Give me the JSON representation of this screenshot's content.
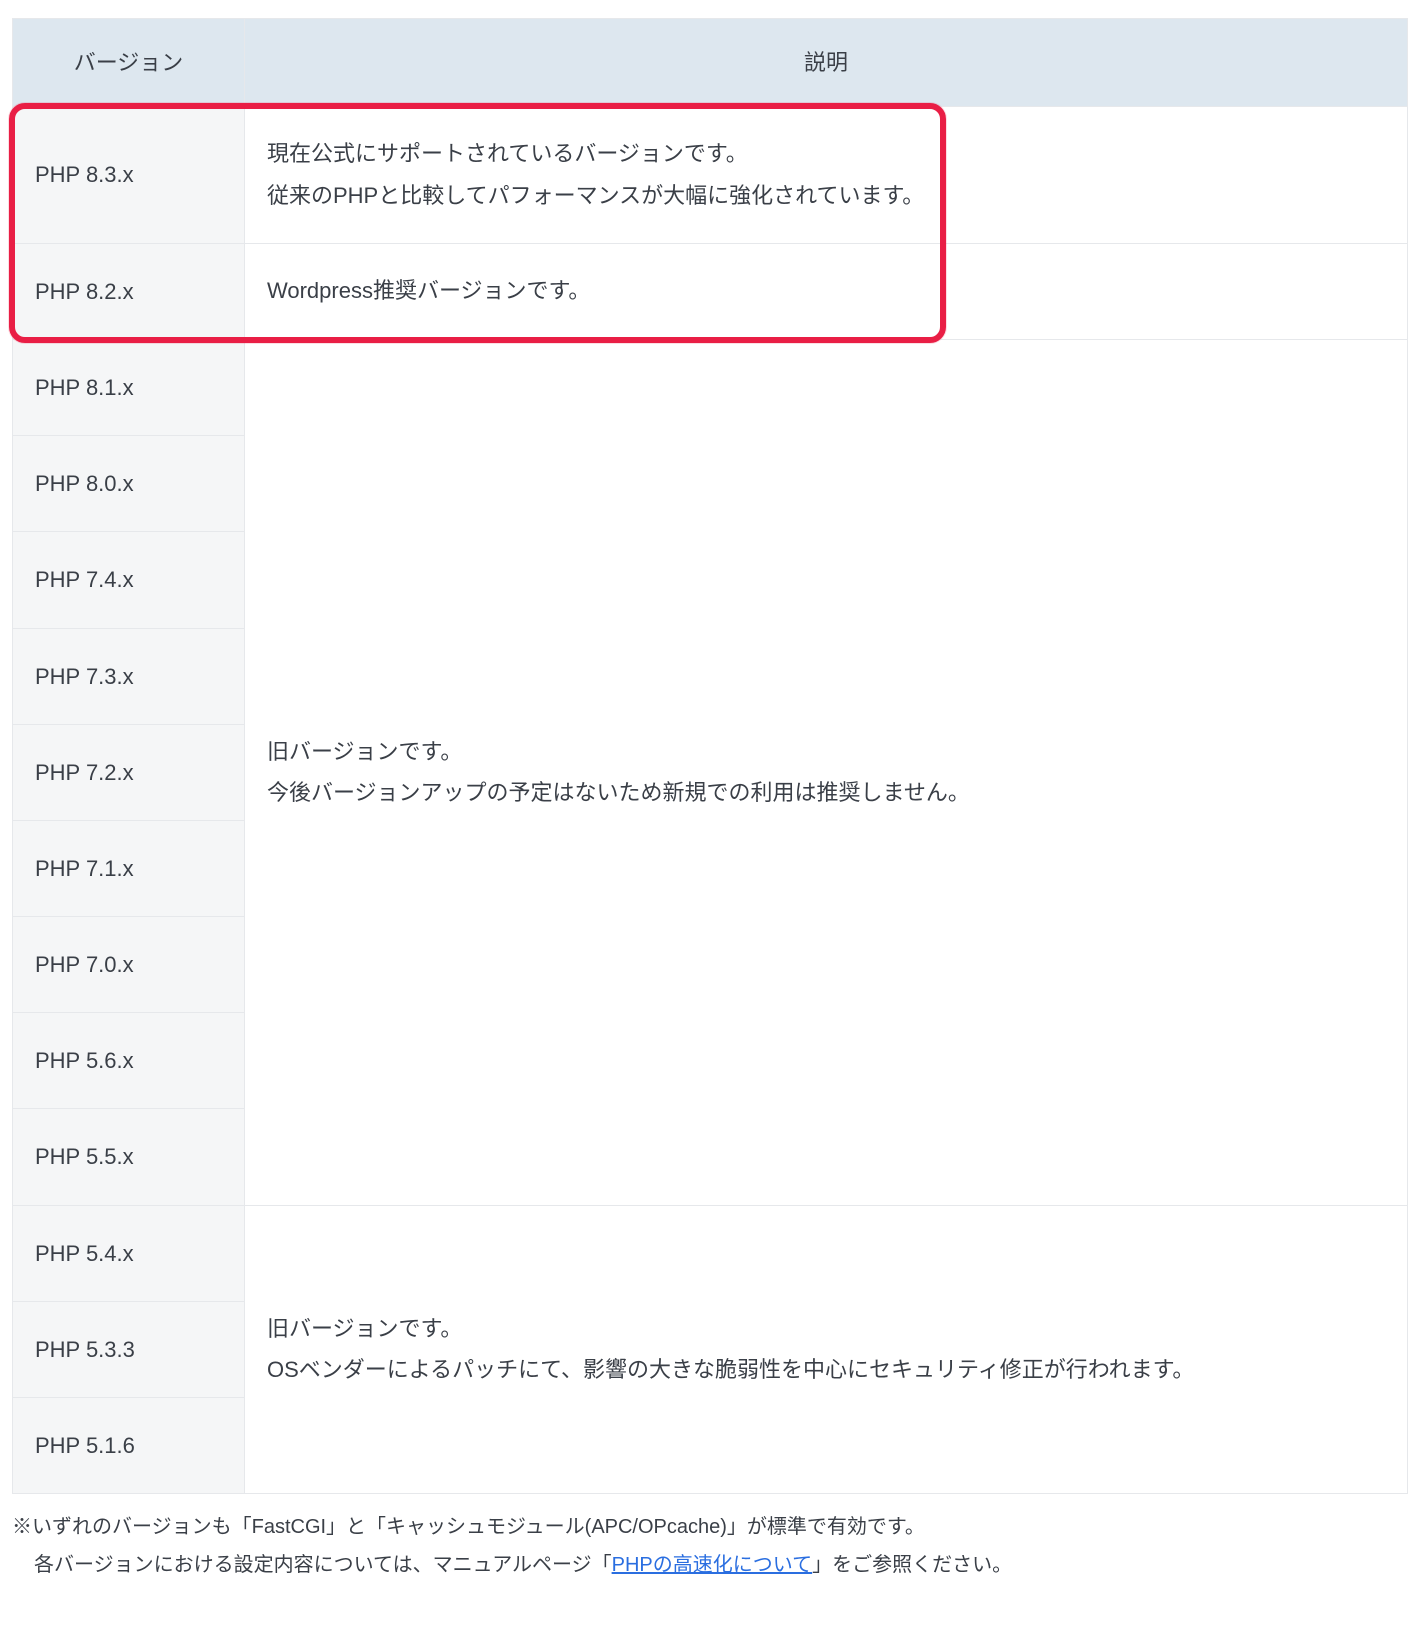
{
  "table": {
    "headers": {
      "version": "バージョン",
      "description": "説明"
    },
    "groups": [
      {
        "highlight": true,
        "rows": [
          {
            "version": "PHP 8.3.x",
            "description": "現在公式にサポートされているバージョンです。\n従来のPHPと比較してパフォーマンスが大幅に強化されています。"
          },
          {
            "version": "PHP 8.2.x",
            "description": "Wordpress推奨バージョンです。"
          }
        ]
      },
      {
        "description": "旧バージョンです。\n今後バージョンアップの予定はないため新規での利用は推奨しません。",
        "rows": [
          {
            "version": "PHP 8.1.x"
          },
          {
            "version": "PHP 8.0.x"
          },
          {
            "version": "PHP 7.4.x"
          },
          {
            "version": "PHP 7.3.x"
          },
          {
            "version": "PHP 7.2.x"
          },
          {
            "version": "PHP 7.1.x"
          },
          {
            "version": "PHP 7.0.x"
          },
          {
            "version": "PHP 5.6.x"
          },
          {
            "version": "PHP 5.5.x"
          }
        ]
      },
      {
        "description": "旧バージョンです。\nOSベンダーによるパッチにて、影響の大きな脆弱性を中心にセキュリティ修正が行われます。",
        "rows": [
          {
            "version": "PHP 5.4.x"
          },
          {
            "version": "PHP 5.3.3"
          },
          {
            "version": "PHP 5.1.6"
          }
        ]
      }
    ]
  },
  "notes": {
    "line1": "※いずれのバージョンも「FastCGI」と「キャッシュモジュール(APC/OPcache)」が標準で有効です。",
    "line2_prefix": "各バージョンにおける設定内容については、マニュアルページ「",
    "line2_link": "PHPの高速化について",
    "line2_suffix": "」をご参照ください。"
  }
}
